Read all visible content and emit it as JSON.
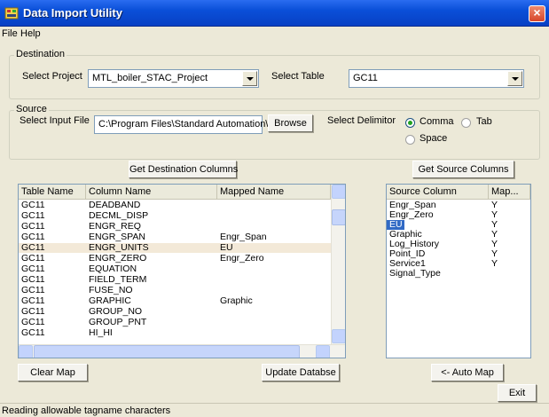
{
  "window": {
    "title": "Data Import Utility"
  },
  "menu": [
    {
      "label": "File"
    },
    {
      "label": "Help"
    }
  ],
  "destination": {
    "group_label": "Destination",
    "project_label": "Select Project",
    "project_value": "MTL_boiler_STAC_Project",
    "table_label": "Select Table",
    "table_value": "GC11"
  },
  "source": {
    "group_label": "Source",
    "input_file_label": "Select Input File",
    "input_file_value": "C:\\Program Files\\Standard Automation\\",
    "browse_label": "Browse",
    "delimitor_label": "Select Delimitor",
    "options": [
      {
        "label": "Comma",
        "checked": true
      },
      {
        "label": "Tab",
        "checked": false
      },
      {
        "label": "Space",
        "checked": false
      }
    ]
  },
  "buttons": {
    "get_destination_columns": "Get Destination Columns",
    "get_source_columns": "Get Source Columns",
    "clear_map": "Clear Map",
    "update_database": "Update Databse",
    "auto_map": "<- Auto Map",
    "exit": "Exit"
  },
  "destination_list": {
    "headers": [
      "Table Name",
      "Column Name",
      "Mapped Name"
    ],
    "rows": [
      [
        "GC11",
        "DEADBAND",
        ""
      ],
      [
        "GC11",
        "DECML_DISP",
        ""
      ],
      [
        "GC11",
        "ENGR_REQ",
        ""
      ],
      [
        "GC11",
        "ENGR_SPAN",
        "Engr_Span"
      ],
      [
        "GC11",
        "ENGR_UNITS",
        "EU"
      ],
      [
        "GC11",
        "ENGR_ZERO",
        "Engr_Zero"
      ],
      [
        "GC11",
        "EQUATION",
        ""
      ],
      [
        "GC11",
        "FIELD_TERM",
        ""
      ],
      [
        "GC11",
        "FUSE_NO",
        ""
      ],
      [
        "GC11",
        "GRAPHIC",
        "Graphic"
      ],
      [
        "GC11",
        "GROUP_NO",
        ""
      ],
      [
        "GC11",
        "GROUP_PNT",
        ""
      ],
      [
        "GC11",
        "HI_HI",
        ""
      ]
    ],
    "selected_row": 4
  },
  "source_list": {
    "headers": [
      "Source Column",
      "Map..."
    ],
    "rows": [
      [
        "Engr_Span",
        "Y"
      ],
      [
        "Engr_Zero",
        "Y"
      ],
      [
        "EU",
        "Y"
      ],
      [
        "Graphic",
        "Y"
      ],
      [
        "Log_History",
        "Y"
      ],
      [
        "Point_ID",
        "Y"
      ],
      [
        "Service1",
        "Y"
      ],
      [
        "Signal_Type",
        ""
      ]
    ],
    "selected_row": 2
  },
  "status": {
    "text": "Reading allowable tagname characters"
  }
}
